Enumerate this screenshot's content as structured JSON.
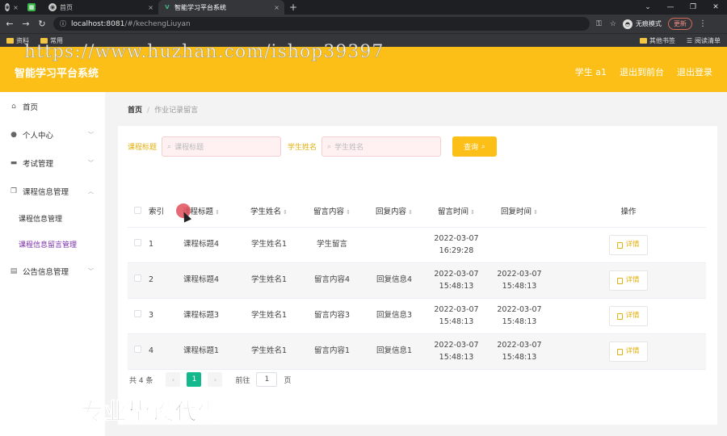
{
  "browser": {
    "tabs": [
      {
        "label": ""
      },
      {
        "label": ""
      },
      {
        "label": "首页"
      },
      {
        "label": "智能学习平台系统"
      }
    ],
    "url_host": "localhost:8081",
    "url_path": "/#/kechengLiuyan",
    "profile_label": "无痕模式",
    "update_label": "更新",
    "bookmarks": [
      "资料",
      "常用"
    ],
    "bookmarks_right": [
      "其他书签",
      "阅读清单"
    ]
  },
  "watermark": "https://www.huzhan.com/ishop39397",
  "header": {
    "title": "智能学习平台系统",
    "user": "学生 a1",
    "back_front": "退出到前台",
    "logout": "退出登录"
  },
  "sidebar": {
    "items": [
      {
        "label": "首页",
        "icon": "home-icon"
      },
      {
        "label": "个人中心",
        "icon": "user-icon"
      },
      {
        "label": "考试管理",
        "icon": "chat-icon"
      },
      {
        "label": "课程信息管理",
        "icon": "copy-icon"
      }
    ],
    "sub_items": [
      {
        "label": "课程信息管理"
      },
      {
        "label": "课程信息留言管理"
      }
    ],
    "last_item": {
      "label": "公告信息管理",
      "icon": "clipboard-icon"
    }
  },
  "breadcrumb": {
    "home": "首页",
    "sep": "/",
    "current": "作业记录留言"
  },
  "search": {
    "title_label": "课程标题",
    "title_placeholder": "课程标题",
    "name_label": "学生姓名",
    "name_placeholder": "学生姓名",
    "button": "查询"
  },
  "table": {
    "headers": {
      "index": "索引",
      "title": "课程标题",
      "name": "学生姓名",
      "msg": "留言内容",
      "reply": "回复内容",
      "mtime": "留言时间",
      "rtime": "回复时间",
      "op": "操作"
    },
    "rows": [
      {
        "index": "1",
        "title": "课程标题4",
        "name": "学生姓名1",
        "msg": "学生留言",
        "reply": "",
        "mtime": "2022-03-07 16:29:28",
        "rtime": "",
        "op": "详情"
      },
      {
        "index": "2",
        "title": "课程标题4",
        "name": "学生姓名1",
        "msg": "留言内容4",
        "reply": "回复信息4",
        "mtime": "2022-03-07 15:48:13",
        "rtime": "2022-03-07 15:48:13",
        "op": "详情"
      },
      {
        "index": "3",
        "title": "课程标题3",
        "name": "学生姓名1",
        "msg": "留言内容3",
        "reply": "回复信息3",
        "mtime": "2022-03-07 15:48:13",
        "rtime": "2022-03-07 15:48:13",
        "op": "详情"
      },
      {
        "index": "4",
        "title": "课程标题1",
        "name": "学生姓名1",
        "msg": "留言内容1",
        "reply": "回复信息1",
        "mtime": "2022-03-07 15:48:13",
        "rtime": "2022-03-07 15:48:13",
        "op": "详情"
      }
    ]
  },
  "pager": {
    "total": "共 4 条",
    "current": "1",
    "goto_label": "前往",
    "goto_value": "1",
    "page_unit": "页"
  },
  "overlay_text": "专业毕设代做",
  "colors": {
    "accent": "#fcbf17",
    "active_menu": "#7b2fa8",
    "page_green": "#13b98c"
  }
}
